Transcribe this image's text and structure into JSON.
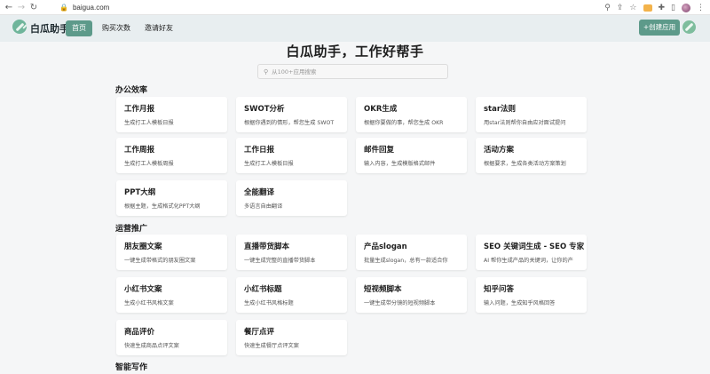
{
  "browser": {
    "url": "baigua.com"
  },
  "header": {
    "brand": "白瓜助手",
    "nav": [
      "首页",
      "购买次数",
      "邀请好友"
    ],
    "create_label": "+创建应用"
  },
  "main": {
    "title": "白瓜助手，工作好帮手",
    "search_placeholder": "从100+应用搜索"
  },
  "sections": [
    {
      "title": "办公效率",
      "cards": [
        {
          "title": "工作月报",
          "desc": "生成打工人模板日报"
        },
        {
          "title": "SWOT分析",
          "desc": "根据你遇到的情形，帮您生成 SWOT"
        },
        {
          "title": "OKR生成",
          "desc": "根据你要做的事，帮您生成 OKR"
        },
        {
          "title": "star法则",
          "desc": "用star法则帮你自由应对面试提问"
        },
        {
          "title": "工作周报",
          "desc": "生成打工人模板周报"
        },
        {
          "title": "工作日报",
          "desc": "生成打工人模板日报"
        },
        {
          "title": "邮件回复",
          "desc": "输入内容，生成模版格式邮件"
        },
        {
          "title": "活动方案",
          "desc": "根据要求，生成各类活动方案策划"
        },
        {
          "title": "PPT大纲",
          "desc": "根据主题，生成格式化PPT大纲"
        },
        {
          "title": "全能翻译",
          "desc": "多语言自由翻译"
        }
      ]
    },
    {
      "title": "运营推广",
      "cards": [
        {
          "title": "朋友圈文案",
          "desc": "一键生成带格式的朋友圈文案"
        },
        {
          "title": "直播带货脚本",
          "desc": "一键生成完整的直播带货脚本"
        },
        {
          "title": "产品slogan",
          "desc": "批量生成slogan，总有一款适合你"
        },
        {
          "title": "SEO 关键词生成 - SEO 专家",
          "desc": "AI 帮你生成产品的关键词，让你的产"
        },
        {
          "title": "小红书文案",
          "desc": "生成小红书风格文案"
        },
        {
          "title": "小红书标题",
          "desc": "生成小红书风格标题"
        },
        {
          "title": "短视频脚本",
          "desc": "一键生成带分镜的短视频脚本"
        },
        {
          "title": "知乎问答",
          "desc": "输入问题，生成知乎风格回答"
        },
        {
          "title": "商品评价",
          "desc": "快速生成商品点评文案"
        },
        {
          "title": "餐厅点评",
          "desc": "快速生成餐厅点评文案"
        }
      ]
    },
    {
      "title": "智能写作",
      "cards": []
    }
  ]
}
